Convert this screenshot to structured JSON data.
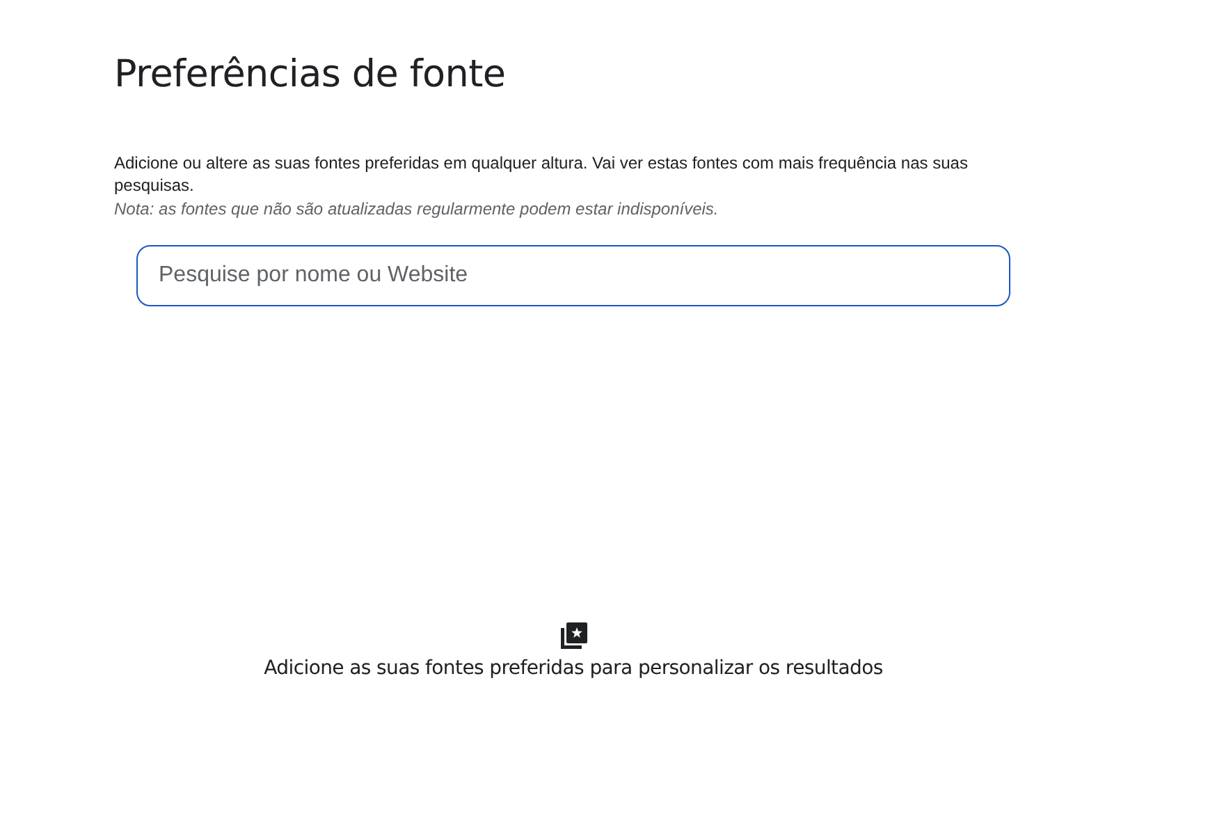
{
  "title": "Preferências de fonte",
  "description": "Adicione ou altere as suas fontes preferidas em qualquer altura. Vai ver estas fontes com mais frequência nas suas pesquisas.",
  "note": "Nota: as fontes que não são atualizadas regularmente podem estar indisponíveis.",
  "search": {
    "placeholder": "Pesquise por nome ou Website"
  },
  "empty_state": {
    "message": "Adicione as suas fontes preferidas para personalizar os resultados"
  }
}
